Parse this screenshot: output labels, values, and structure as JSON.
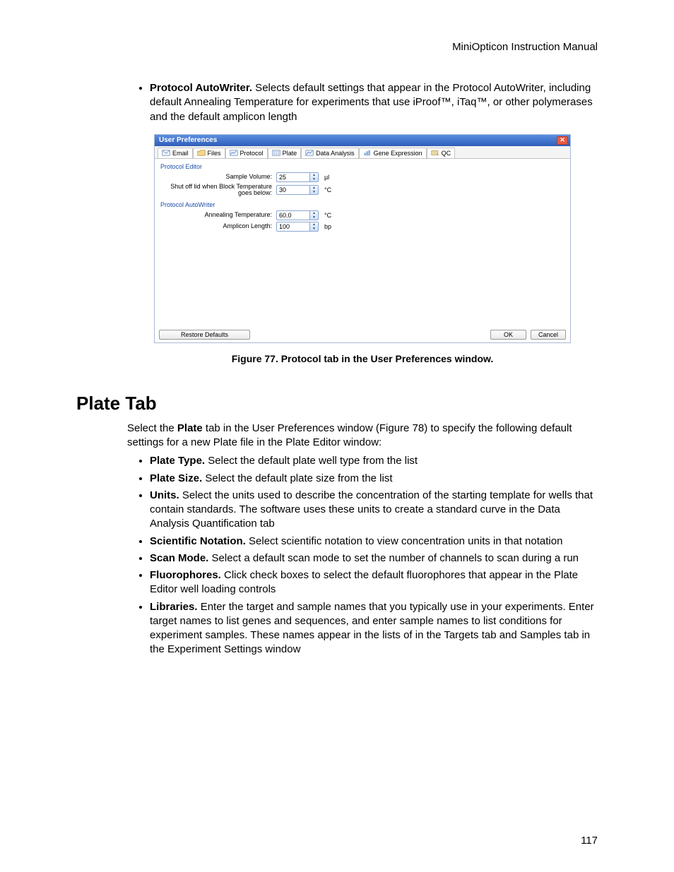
{
  "header": "MiniOpticon Instruction Manual",
  "intro_bullets": [
    {
      "label": "Protocol AutoWriter.",
      "text": " Selects default settings that appear in the Protocol AutoWriter, including default Annealing Temperature for experiments that use iProof™, iTaq™, or other polymerases and the default amplicon length"
    }
  ],
  "figure_caption": "Figure 77. Protocol tab in the User Preferences window.",
  "section_heading": "Plate Tab",
  "section_intro_pre": "Select the ",
  "section_intro_bold": "Plate",
  "section_intro_post": " tab in the User Preferences window (Figure 78) to specify the following default settings for a new Plate file in the Plate Editor window:",
  "plate_bullets": [
    {
      "label": "Plate Type.",
      "text": " Select the default plate well type from the list"
    },
    {
      "label": "Plate Size.",
      "text": " Select the default plate size from the list"
    },
    {
      "label": "Units.",
      "text": " Select the units used to describe the concentration of the starting template for wells that contain standards. The software uses these units to create a standard curve in the Data Analysis Quantification tab"
    },
    {
      "label": "Scientific Notation.",
      "text": " Select scientific notation to view concentration units in that notation"
    },
    {
      "label": "Scan Mode.",
      "text": " Select a default scan mode to set the number of channels to scan during a run"
    },
    {
      "label": "Fluorophores.",
      "text": " Click check boxes to select the default fluorophores that appear in the Plate Editor well loading controls"
    },
    {
      "label": "Libraries.",
      "text": " Enter the target and sample names that you typically use in your experiments. Enter target names to list genes and sequences, and enter sample names to list conditions for experiment samples. These names appear in the lists of in the Targets tab and Samples tab in the Experiment Settings window"
    }
  ],
  "page_number": "117",
  "window": {
    "title": "User Preferences",
    "tabs": [
      "Email",
      "Files",
      "Protocol",
      "Plate",
      "Data Analysis",
      "Gene Expression",
      "QC"
    ],
    "groups": {
      "editor_label": "Protocol Editor",
      "autowriter_label": "Protocol AutoWriter"
    },
    "fields": {
      "sample_volume": {
        "label": "Sample Volume:",
        "value": "25",
        "unit": "µl"
      },
      "shutoff": {
        "label": "Shut off lid when Block Temperature goes below:",
        "value": "30",
        "unit": "°C"
      },
      "annealing": {
        "label": "Annealing Temperature:",
        "value": "60.0",
        "unit": "°C"
      },
      "amplicon": {
        "label": "Amplicon Length:",
        "value": "100",
        "unit": "bp"
      }
    },
    "buttons": {
      "restore": "Restore Defaults",
      "ok": "OK",
      "cancel": "Cancel"
    }
  }
}
